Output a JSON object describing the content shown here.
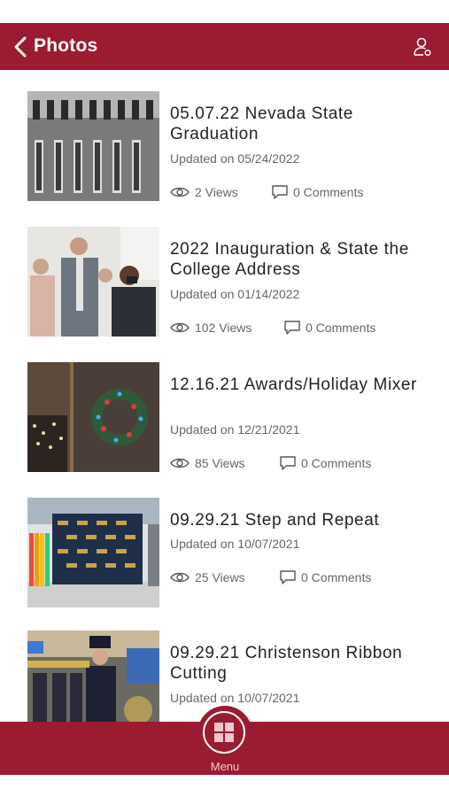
{
  "header": {
    "title": "Photos"
  },
  "items": [
    {
      "title": "05.07.22 Nevada State Graduation",
      "date": "Updated on 05/24/2022",
      "views": "2 Views",
      "comments": "0 Comments"
    },
    {
      "title": "2022 Inauguration & State the College Address",
      "date": "Updated on 01/14/2022",
      "views": "102 Views",
      "comments": "0 Comments"
    },
    {
      "title": "12.16.21 Awards/Holiday Mixer",
      "date": "Updated on 12/21/2021",
      "views": "85 Views",
      "comments": "0 Comments"
    },
    {
      "title": "09.29.21 Step and Repeat",
      "date": "Updated on 10/07/2021",
      "views": "25 Views",
      "comments": "0 Comments"
    },
    {
      "title": "09.29.21 Christenson Ribbon Cutting",
      "date": "Updated on 10/07/2021"
    }
  ],
  "bottom_nav": {
    "menu_label": "Menu"
  },
  "colors": {
    "brand": "#9b1b30",
    "text": "#222222",
    "muted": "#666666"
  },
  "icons": [
    "chevron-left-icon",
    "user-settings-icon",
    "eye-icon",
    "comment-icon",
    "grid-menu-icon"
  ]
}
